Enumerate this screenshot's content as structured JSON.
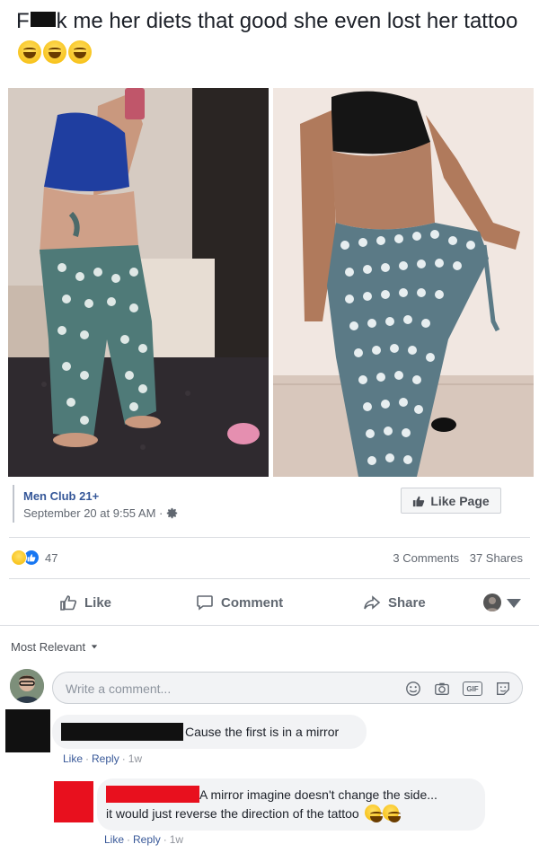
{
  "post": {
    "text_part1": "F",
    "text_part2": "k me her diets that good she even lost her tattoo",
    "emoji_count": 3
  },
  "page": {
    "name": "Men Club 21+",
    "timestamp": "September 20 at 9:55 AM ·",
    "like_page_label": "Like Page"
  },
  "stats": {
    "reactions": "47",
    "comments": "3 Comments",
    "shares": "37 Shares"
  },
  "actions": {
    "like": "Like",
    "comment": "Comment",
    "share": "Share"
  },
  "comments_section": {
    "sort_label": "Most Relevant",
    "write_placeholder": "Write a comment...",
    "gif_label": "GIF"
  },
  "comments": [
    {
      "text": "Cause the first is in a mirror",
      "like": "Like",
      "reply": "Reply",
      "time": "1w"
    },
    {
      "text_line1": "A mirror imagine doesn't change the side...",
      "text_line2": "it would just reverse the direction of the tattoo",
      "like": "Like",
      "reply": "Reply",
      "time": "1w"
    }
  ],
  "colors": {
    "link_blue": "#365899",
    "redaction_black": "#111111",
    "redaction_red": "#e8101e",
    "fb_blue": "#1877f2"
  }
}
